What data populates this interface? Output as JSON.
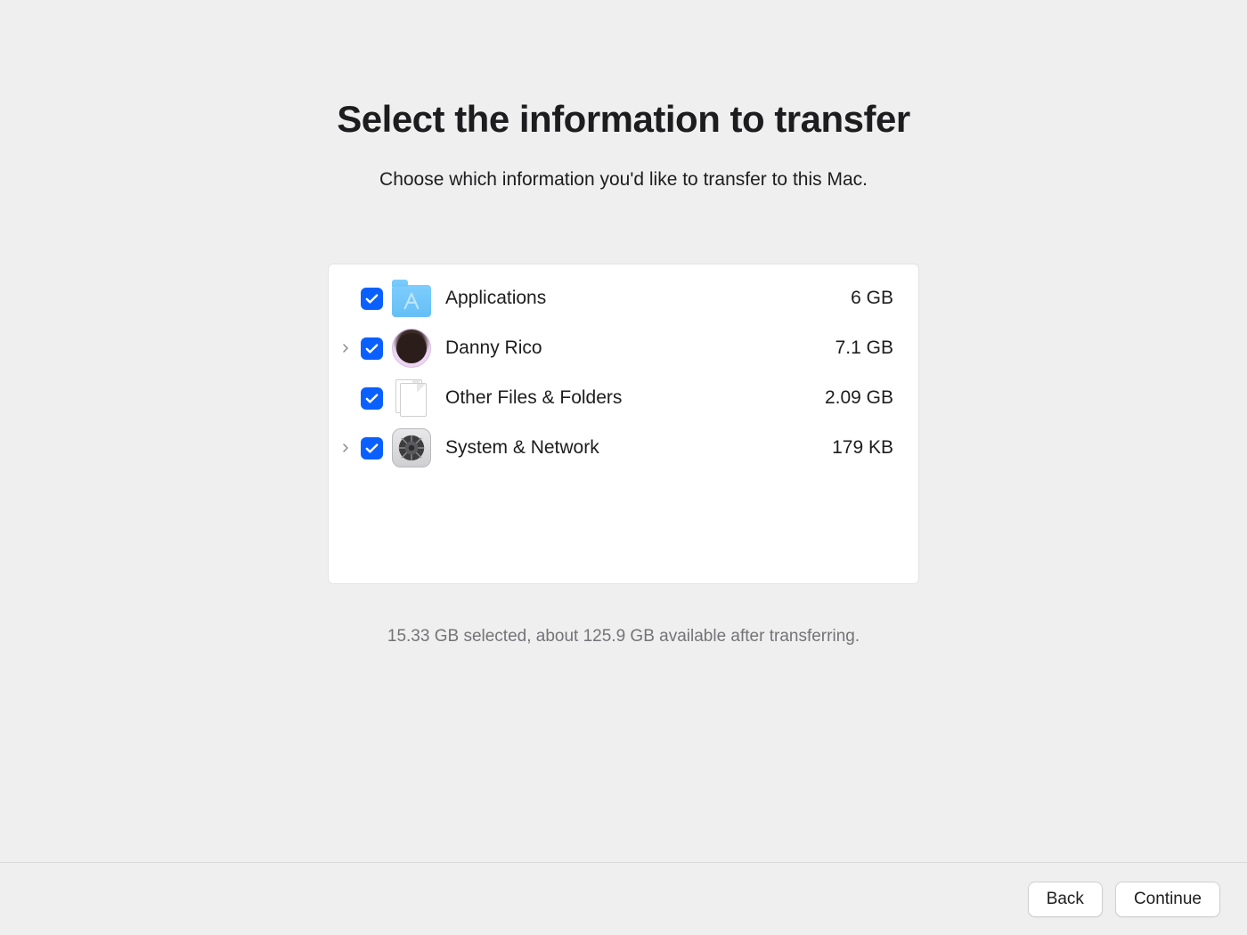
{
  "header": {
    "title": "Select the information to transfer",
    "subtitle": "Choose which information you'd like to transfer to this Mac."
  },
  "items": [
    {
      "label": "Applications",
      "size": "6 GB",
      "checked": true,
      "expandable": false,
      "icon": "applications"
    },
    {
      "label": "Danny Rico",
      "size": "7.1 GB",
      "checked": true,
      "expandable": true,
      "icon": "avatar"
    },
    {
      "label": "Other Files & Folders",
      "size": "2.09 GB",
      "checked": true,
      "expandable": false,
      "icon": "files"
    },
    {
      "label": "System & Network",
      "size": "179 KB",
      "checked": true,
      "expandable": true,
      "icon": "settings"
    }
  ],
  "status": "15.33 GB selected, about 125.9 GB available after transferring.",
  "footer": {
    "back": "Back",
    "continue": "Continue"
  }
}
